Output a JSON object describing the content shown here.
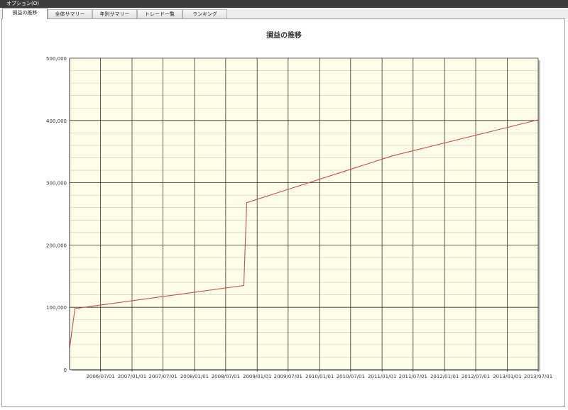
{
  "menu": {
    "options_label": "オプション(O)"
  },
  "tabs": [
    {
      "label": "損益の推移",
      "active": true
    },
    {
      "label": "全体サマリー",
      "active": false
    },
    {
      "label": "年別サマリー",
      "active": false
    },
    {
      "label": "トレード一覧",
      "active": false
    },
    {
      "label": "ランキング",
      "active": false
    }
  ],
  "colors": {
    "plot_background": "#fefee8",
    "line": "#c0504d",
    "grid_major": "#333333",
    "grid_minor": "#c8c8c8"
  },
  "chart_data": {
    "type": "line",
    "title": "損益の推移",
    "xlabel": "",
    "ylabel": "",
    "x_range": [
      "2006-01-01",
      "2013-07-01"
    ],
    "ylim": [
      0,
      500000
    ],
    "y_ticks": [
      0,
      100000,
      200000,
      300000,
      400000,
      500000
    ],
    "y_tick_labels": [
      "0",
      "100,000",
      "200,000",
      "300,000",
      "400,000",
      "500,000"
    ],
    "x_tick_labels": [
      "2006/07/01",
      "2007/01/01",
      "2007/07/01",
      "2008/01/01",
      "2008/07/01",
      "2009/01/01",
      "2009/07/01",
      "2010/01/01",
      "2010/07/01",
      "2011/01/01",
      "2011/07/01",
      "2012/01/01",
      "2012/07/01",
      "2013/01/01",
      "2013/07/01"
    ],
    "grid": true,
    "legend": "none",
    "series": [
      {
        "x": [
          "2006-01-01",
          "2006-02-01",
          "2008-10-15",
          "2008-11-01",
          "2011-03-01",
          "2013-07-01"
        ],
        "values": [
          34000,
          98000,
          135000,
          268000,
          343000,
          401000
        ]
      }
    ]
  }
}
